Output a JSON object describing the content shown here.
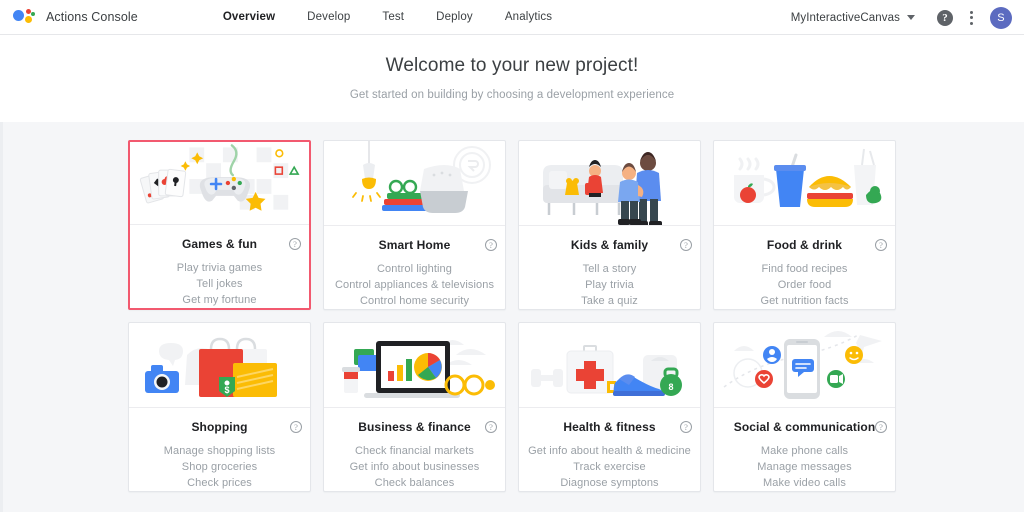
{
  "header": {
    "logo_icon": "google-assistant-logo",
    "brand": "Actions Console",
    "nav": [
      {
        "label": "Overview",
        "active": true
      },
      {
        "label": "Develop",
        "active": false
      },
      {
        "label": "Test",
        "active": false
      },
      {
        "label": "Deploy",
        "active": false
      },
      {
        "label": "Analytics",
        "active": false
      }
    ],
    "project_name": "MyInteractiveCanvas",
    "caret_icon": "chevron-down-icon",
    "help_icon": "help-icon",
    "help_glyph": "?",
    "kebab_icon": "more-options-icon",
    "avatar_icon": "user-avatar",
    "avatar_initial": "S"
  },
  "title_band": {
    "title": "Welcome to your new project!",
    "subtitle": "Get started on building by choosing a development experience"
  },
  "colors": {
    "selected_border": "#f2596f",
    "page_background": "#f5f6f8",
    "card_background": "#ffffff",
    "avatar": "#5c6bc0",
    "google_blue": "#4285F4",
    "google_red": "#EA4335",
    "google_yellow": "#FBBC05",
    "google_green": "#34A853"
  },
  "cards": [
    {
      "id": "games-fun",
      "title": "Games & fun",
      "illustration": "gamepad-and-cards-illustration",
      "help_glyph": "?",
      "selected": true,
      "items": [
        "Play trivia games",
        "Tell jokes",
        "Get my fortune"
      ]
    },
    {
      "id": "smart-home",
      "title": "Smart Home",
      "illustration": "smart-speaker-and-lamp-illustration",
      "help_glyph": "?",
      "selected": false,
      "items": [
        "Control lighting",
        "Control appliances & televisions",
        "Control home security"
      ]
    },
    {
      "id": "kids-family",
      "title": "Kids & family",
      "illustration": "family-on-couch-illustration",
      "help_glyph": "?",
      "selected": false,
      "items": [
        "Tell a story",
        "Play trivia",
        "Take a quiz"
      ]
    },
    {
      "id": "food-drink",
      "title": "Food & drink",
      "illustration": "burger-and-drink-illustration",
      "help_glyph": "?",
      "selected": false,
      "items": [
        "Find food recipes",
        "Order food",
        "Get nutrition facts"
      ]
    },
    {
      "id": "shopping",
      "title": "Shopping",
      "illustration": "shopping-bags-and-camera-illustration",
      "help_glyph": "?",
      "selected": false,
      "items": [
        "Manage shopping lists",
        "Shop groceries",
        "Check prices"
      ]
    },
    {
      "id": "business-finance",
      "title": "Business & finance",
      "illustration": "laptop-charts-illustration",
      "help_glyph": "?",
      "selected": false,
      "items": [
        "Check financial markets",
        "Get info about businesses",
        "Check balances"
      ]
    },
    {
      "id": "health-fitness",
      "title": "Health & fitness",
      "illustration": "first-aid-kit-and-sneaker-illustration",
      "help_glyph": "?",
      "selected": false,
      "items": [
        "Get info about health & medicine",
        "Track exercise",
        "Diagnose symptons"
      ]
    },
    {
      "id": "social-communication",
      "title": "Social & communication",
      "illustration": "phone-with-chat-bubbles-illustration",
      "help_glyph": "?",
      "selected": false,
      "items": [
        "Make phone calls",
        "Manage messages",
        "Make video calls"
      ]
    }
  ]
}
